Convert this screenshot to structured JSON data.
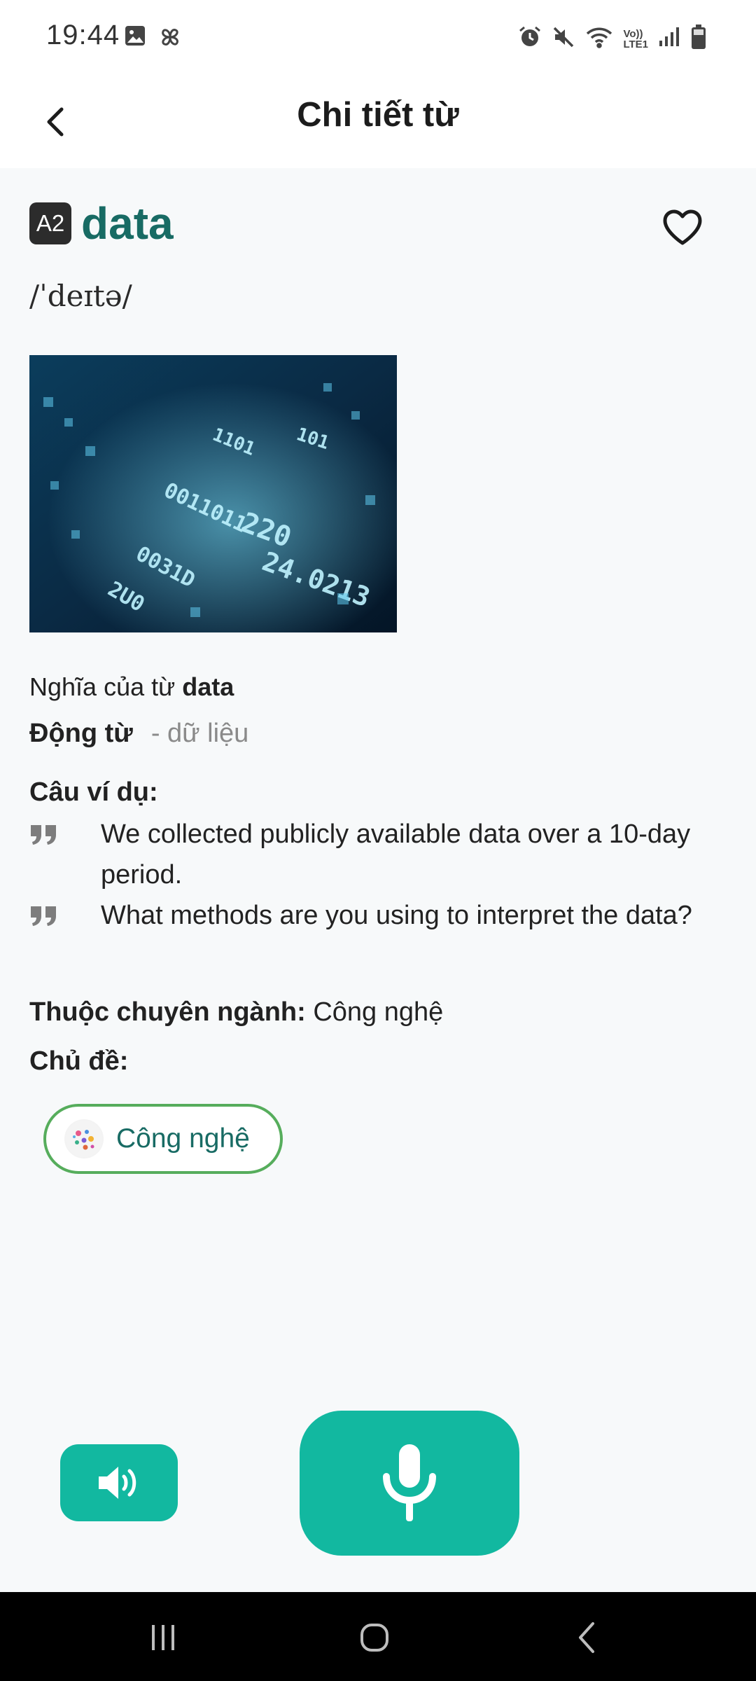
{
  "status_bar": {
    "time": "19:44",
    "left_icons": [
      "gallery-icon",
      "pinwheel-icon"
    ],
    "right_icons": [
      "alarm-icon",
      "mute-icon",
      "wifi-icon",
      "volte-icon",
      "signal-icon",
      "battery-icon"
    ],
    "volte_top": "Vo))",
    "volte_bottom": "LTE1"
  },
  "header": {
    "title": "Chi tiết từ",
    "back_icon": "chevron-left-icon"
  },
  "word": {
    "level": "A2",
    "text": "data",
    "phonetic": "/ˈdeɪtə/",
    "favorite_icon": "heart-outline-icon",
    "image_numbers": [
      "220",
      "24.0213",
      "0011011",
      "0031D",
      "2U0",
      "1101",
      "101"
    ]
  },
  "meaning": {
    "prefix": "Nghĩa của từ",
    "word": "data",
    "part_of_speech": "Động từ",
    "definition": "- dữ liệu"
  },
  "examples": {
    "heading": "Câu ví dụ:",
    "items": [
      "We collected publicly available data over a 10-day period.",
      "What methods are you using to interpret the data?"
    ]
  },
  "field": {
    "label": "Thuộc chuyên ngành:",
    "value": "Công nghệ"
  },
  "topic": {
    "heading": "Chủ đề:",
    "chip_label": "Công nghệ"
  },
  "actions": {
    "speaker_icon": "speaker-icon",
    "mic_icon": "microphone-icon"
  },
  "colors": {
    "accent": "#12b8a0",
    "word": "#186b64",
    "chip_border": "#56ad5c"
  }
}
